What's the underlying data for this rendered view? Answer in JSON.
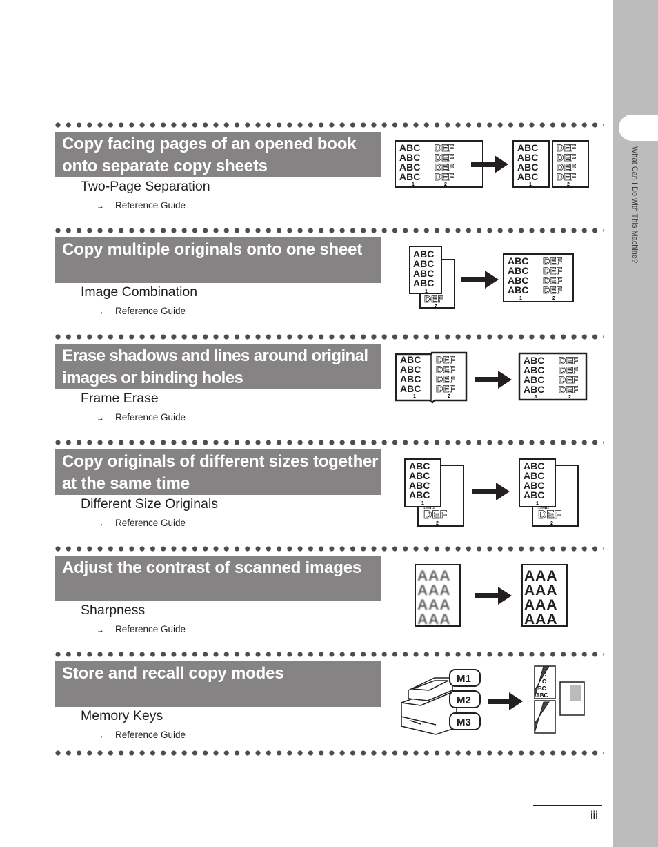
{
  "side_tab": {
    "label": "What Can I Do with This Machine?"
  },
  "sections": [
    {
      "title": "Copy facing pages of an opened book onto separate copy sheets",
      "feature": "Two-Page Separation",
      "reference": "Reference Guide",
      "illustration": "two-page-separation-illustration"
    },
    {
      "title": "Copy multiple originals onto one sheet",
      "feature": "Image Combination",
      "reference": "Reference Guide",
      "illustration": "image-combination-illustration"
    },
    {
      "title": "Erase shadows and lines around original images or binding holes",
      "feature": "Frame Erase",
      "reference": "Reference Guide",
      "illustration": "frame-erase-illustration"
    },
    {
      "title": "Copy originals of different sizes together at the same time",
      "feature": "Different Size Originals",
      "reference": "Reference Guide",
      "illustration": "different-size-originals-illustration"
    },
    {
      "title": "Adjust the contrast of scanned images",
      "feature": "Sharpness",
      "reference": "Reference Guide",
      "illustration": "sharpness-illustration"
    },
    {
      "title": "Store and recall copy modes",
      "feature": "Memory Keys",
      "reference": "Reference Guide",
      "illustration": "memory-keys-illustration"
    }
  ],
  "illustration_text": {
    "abc": "ABC",
    "def": "DEF",
    "aaa": "AAA",
    "page1": "1",
    "page2": "2",
    "memory_keys": [
      "M1",
      "M2",
      "M3"
    ]
  },
  "reference_arrow": "→",
  "page_number": "iii"
}
